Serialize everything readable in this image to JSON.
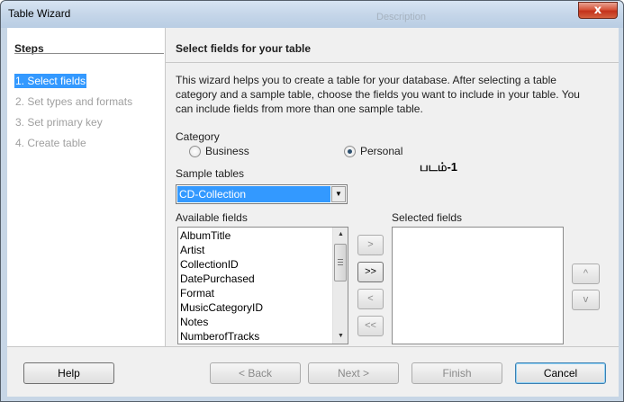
{
  "window": {
    "title": "Table Wizard",
    "background_title": "Description",
    "close_label": "x"
  },
  "steps": {
    "title": "Steps",
    "items": [
      {
        "label": "1. Select fields",
        "active": true
      },
      {
        "label": "2. Set types and formats",
        "active": false
      },
      {
        "label": "3. Set primary key",
        "active": false
      },
      {
        "label": "4. Create table",
        "active": false
      }
    ]
  },
  "main": {
    "heading": "Select fields for your table",
    "description": "This wizard helps you to create a table for your database. After selecting a table category and a sample table, choose the fields you want to include in your table. You can include fields from more than one sample table.",
    "category_label": "Category",
    "categories": [
      {
        "label": "Business",
        "checked": false
      },
      {
        "label": "Personal",
        "checked": true
      }
    ],
    "annotation": "படம்-1",
    "sample_tables_label": "Sample tables",
    "sample_table_value": "CD-Collection",
    "available_fields_label": "Available fields",
    "available_fields": [
      "AlbumTitle",
      "Artist",
      "CollectionID",
      "DatePurchased",
      "Format",
      "MusicCategoryID",
      "Notes",
      "NumberofTracks"
    ],
    "selected_fields_label": "Selected fields",
    "selected_fields": [],
    "move_buttons": [
      ">",
      ">>",
      "<",
      "<<"
    ],
    "order_buttons": [
      "^",
      "v"
    ]
  },
  "footer": {
    "help": "Help",
    "back": "< Back",
    "next": "Next >",
    "finish": "Finish",
    "cancel": "Cancel"
  }
}
